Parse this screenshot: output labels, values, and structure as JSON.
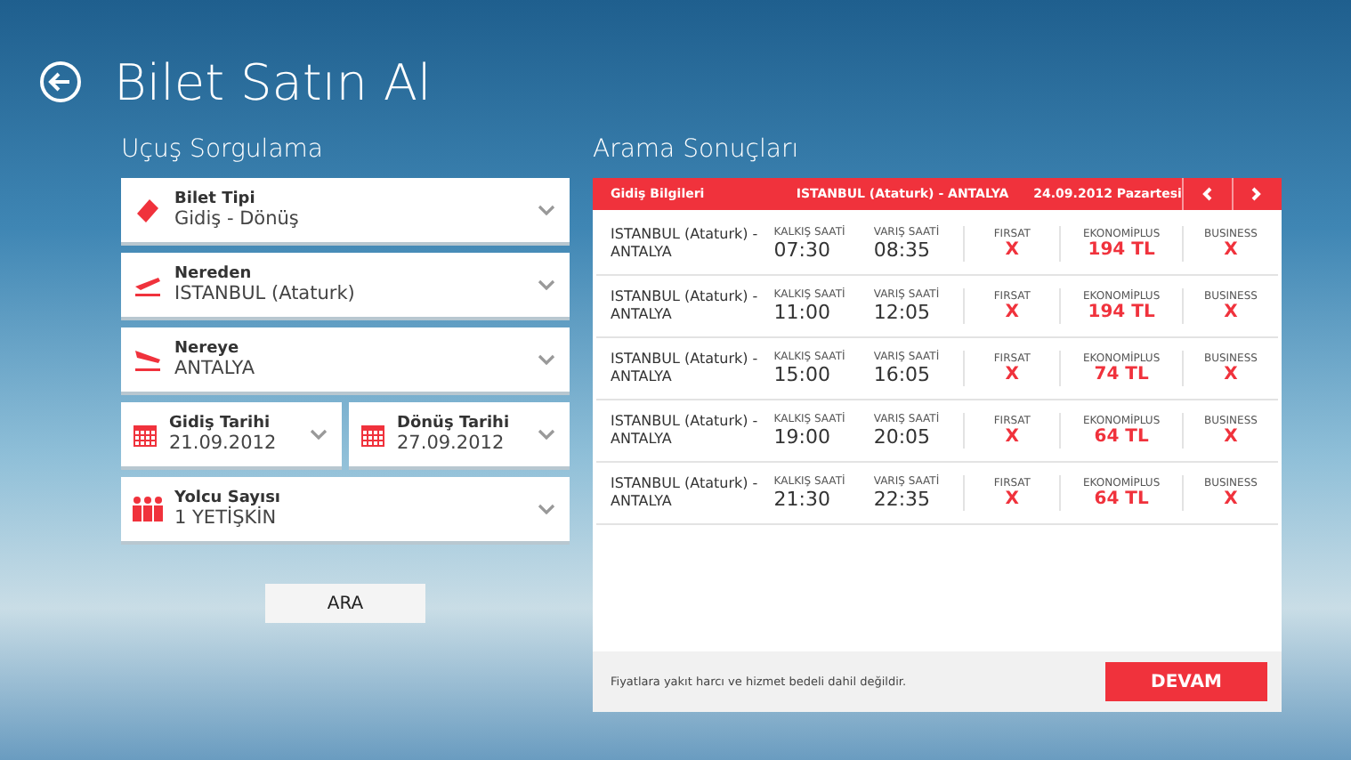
{
  "page_title": "Bilet Satın Al",
  "search": {
    "heading": "Uçuş Sorgulama",
    "fields": [
      {
        "kind": "full",
        "label": "Bilet Tipi",
        "value": "Gidiş - Dönüş"
      },
      {
        "kind": "full",
        "label": "Nereden",
        "value": "ISTANBUL (Ataturk)"
      },
      {
        "kind": "full",
        "label": "Nereye",
        "value": "ANTALYA"
      },
      {
        "kind": "half",
        "label": "Gidiş Tarihi",
        "value": "21.09.2012"
      },
      {
        "kind": "half",
        "label": "Dönüş Tarihi",
        "value": "27.09.2012"
      },
      {
        "kind": "full",
        "label": "Yolcu Sayısı",
        "value": "1 YETİŞKİN"
      }
    ],
    "button": "ARA"
  },
  "results": {
    "heading": "Arama Sonuçları",
    "header": {
      "title": "Gidiş Bilgileri",
      "route": "ISTANBUL (Ataturk) - ANTALYA",
      "date": "24.09.2012 Pazartesi"
    },
    "rows": [
      {
        "route": "ISTANBUL (Ataturk) - ANTALYA",
        "times": [
          {
            "label": "KALKIŞ SAATİ",
            "value": "07:30"
          },
          {
            "label": "VARIŞ SAATİ",
            "value": "08:35"
          }
        ],
        "fares": [
          {
            "label": "FIRSAT",
            "value": "X"
          },
          {
            "label": "EKONOMİPLUS",
            "value": "194 TL"
          },
          {
            "label": "BUSINESS",
            "value": "X"
          }
        ]
      },
      {
        "route": "ISTANBUL (Ataturk) - ANTALYA",
        "times": [
          {
            "label": "KALKIŞ SAATİ",
            "value": "11:00"
          },
          {
            "label": "VARIŞ SAATİ",
            "value": "12:05"
          }
        ],
        "fares": [
          {
            "label": "FIRSAT",
            "value": "X"
          },
          {
            "label": "EKONOMİPLUS",
            "value": "194 TL"
          },
          {
            "label": "BUSINESS",
            "value": "X"
          }
        ]
      },
      {
        "route": "ISTANBUL (Ataturk) - ANTALYA",
        "times": [
          {
            "label": "KALKIŞ SAATİ",
            "value": "15:00"
          },
          {
            "label": "VARIŞ SAATİ",
            "value": "16:05"
          }
        ],
        "fares": [
          {
            "label": "FIRSAT",
            "value": "X"
          },
          {
            "label": "EKONOMİPLUS",
            "value": "74 TL"
          },
          {
            "label": "BUSINESS",
            "value": "X"
          }
        ]
      },
      {
        "route": "ISTANBUL (Ataturk) - ANTALYA",
        "times": [
          {
            "label": "KALKIŞ SAATİ",
            "value": "19:00"
          },
          {
            "label": "VARIŞ SAATİ",
            "value": "20:05"
          }
        ],
        "fares": [
          {
            "label": "FIRSAT",
            "value": "X"
          },
          {
            "label": "EKONOMİPLUS",
            "value": "64 TL"
          },
          {
            "label": "BUSINESS",
            "value": "X"
          }
        ]
      },
      {
        "route": "ISTANBUL (Ataturk) - ANTALYA",
        "times": [
          {
            "label": "KALKIŞ SAATİ",
            "value": "21:30"
          },
          {
            "label": "VARIŞ SAATİ",
            "value": "22:35"
          }
        ],
        "fares": [
          {
            "label": "FIRSAT",
            "value": "X"
          },
          {
            "label": "EKONOMİPLUS",
            "value": "64 TL"
          },
          {
            "label": "BUSINESS",
            "value": "X"
          }
        ]
      }
    ],
    "note": "Fiyatlara yakıt harcı ve hizmet bedeli dahil değildir.",
    "button": "DEVAM"
  }
}
